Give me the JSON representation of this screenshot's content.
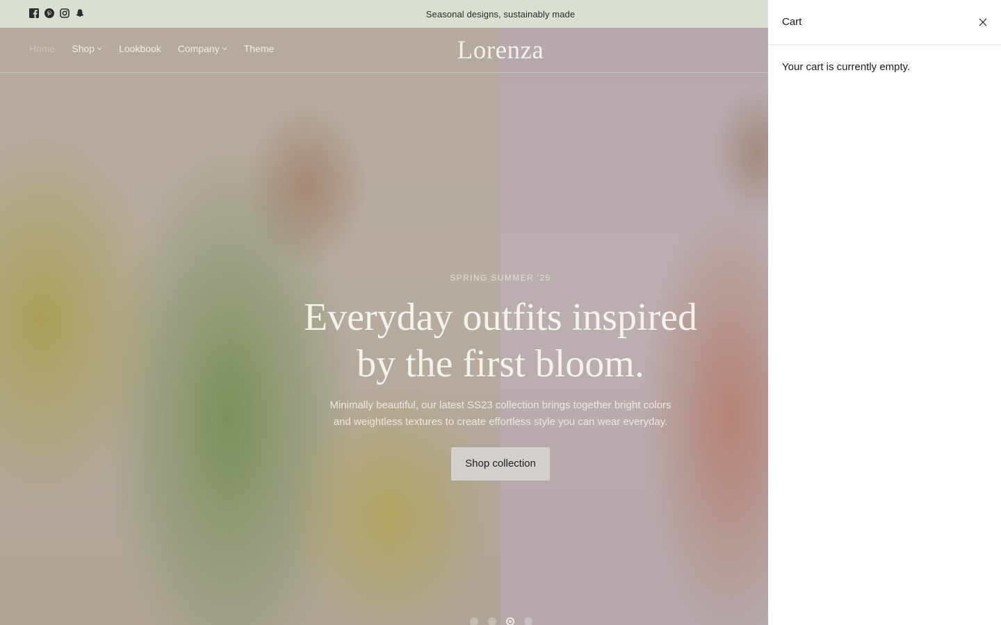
{
  "announcement": {
    "text": "Seasonal designs, sustainably made"
  },
  "social": [
    "facebook-icon",
    "pinterest-icon",
    "instagram-icon",
    "snapchat-icon"
  ],
  "nav": {
    "items": [
      {
        "label": "Home",
        "active": true,
        "dropdown": false
      },
      {
        "label": "Shop",
        "active": false,
        "dropdown": true
      },
      {
        "label": "Lookbook",
        "active": false,
        "dropdown": false
      },
      {
        "label": "Company",
        "active": false,
        "dropdown": true
      },
      {
        "label": "Theme",
        "active": false,
        "dropdown": false
      }
    ],
    "logo": "Lorenza"
  },
  "hero": {
    "eyebrow": "SPRING SUMMER '25",
    "heading_line1": "Everyday outfits inspired",
    "heading_line2": "by the first bloom.",
    "desc_line1": "Minimally beautiful, our latest SS23 collection brings together bright colors",
    "desc_line2": "and weightless textures to create effortless style you can wear everyday.",
    "cta": "Shop collection",
    "slides": 4,
    "active_slide": 3
  },
  "cart": {
    "title": "Cart",
    "empty_message": "Your cart is currently empty."
  },
  "colors": {
    "announcement_bg": "#d9e0d3",
    "drawer_bg": "#ffffff"
  }
}
